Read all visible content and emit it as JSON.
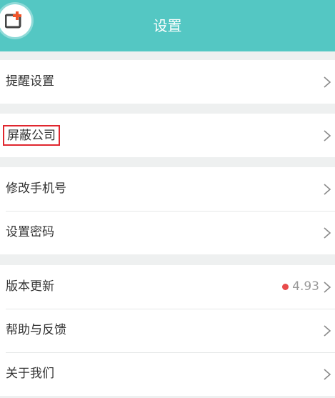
{
  "header": {
    "title": "设置"
  },
  "icons": {
    "logo": "app-logo-icon",
    "chevron": "chevron-right-icon"
  },
  "colors": {
    "header_bg": "#54c7c3",
    "highlight_border": "#e0262e",
    "badge_dot": "#e84b4b"
  },
  "groups": [
    {
      "items": [
        {
          "label": "提醒设置"
        }
      ]
    },
    {
      "items": [
        {
          "label": "屏蔽公司"
        }
      ]
    },
    {
      "items": [
        {
          "label": "修改手机号"
        },
        {
          "label": "设置密码"
        }
      ]
    },
    {
      "items": [
        {
          "label": "版本更新",
          "value": "4.93"
        },
        {
          "label": "帮助与反馈"
        },
        {
          "label": "关于我们"
        }
      ]
    }
  ]
}
